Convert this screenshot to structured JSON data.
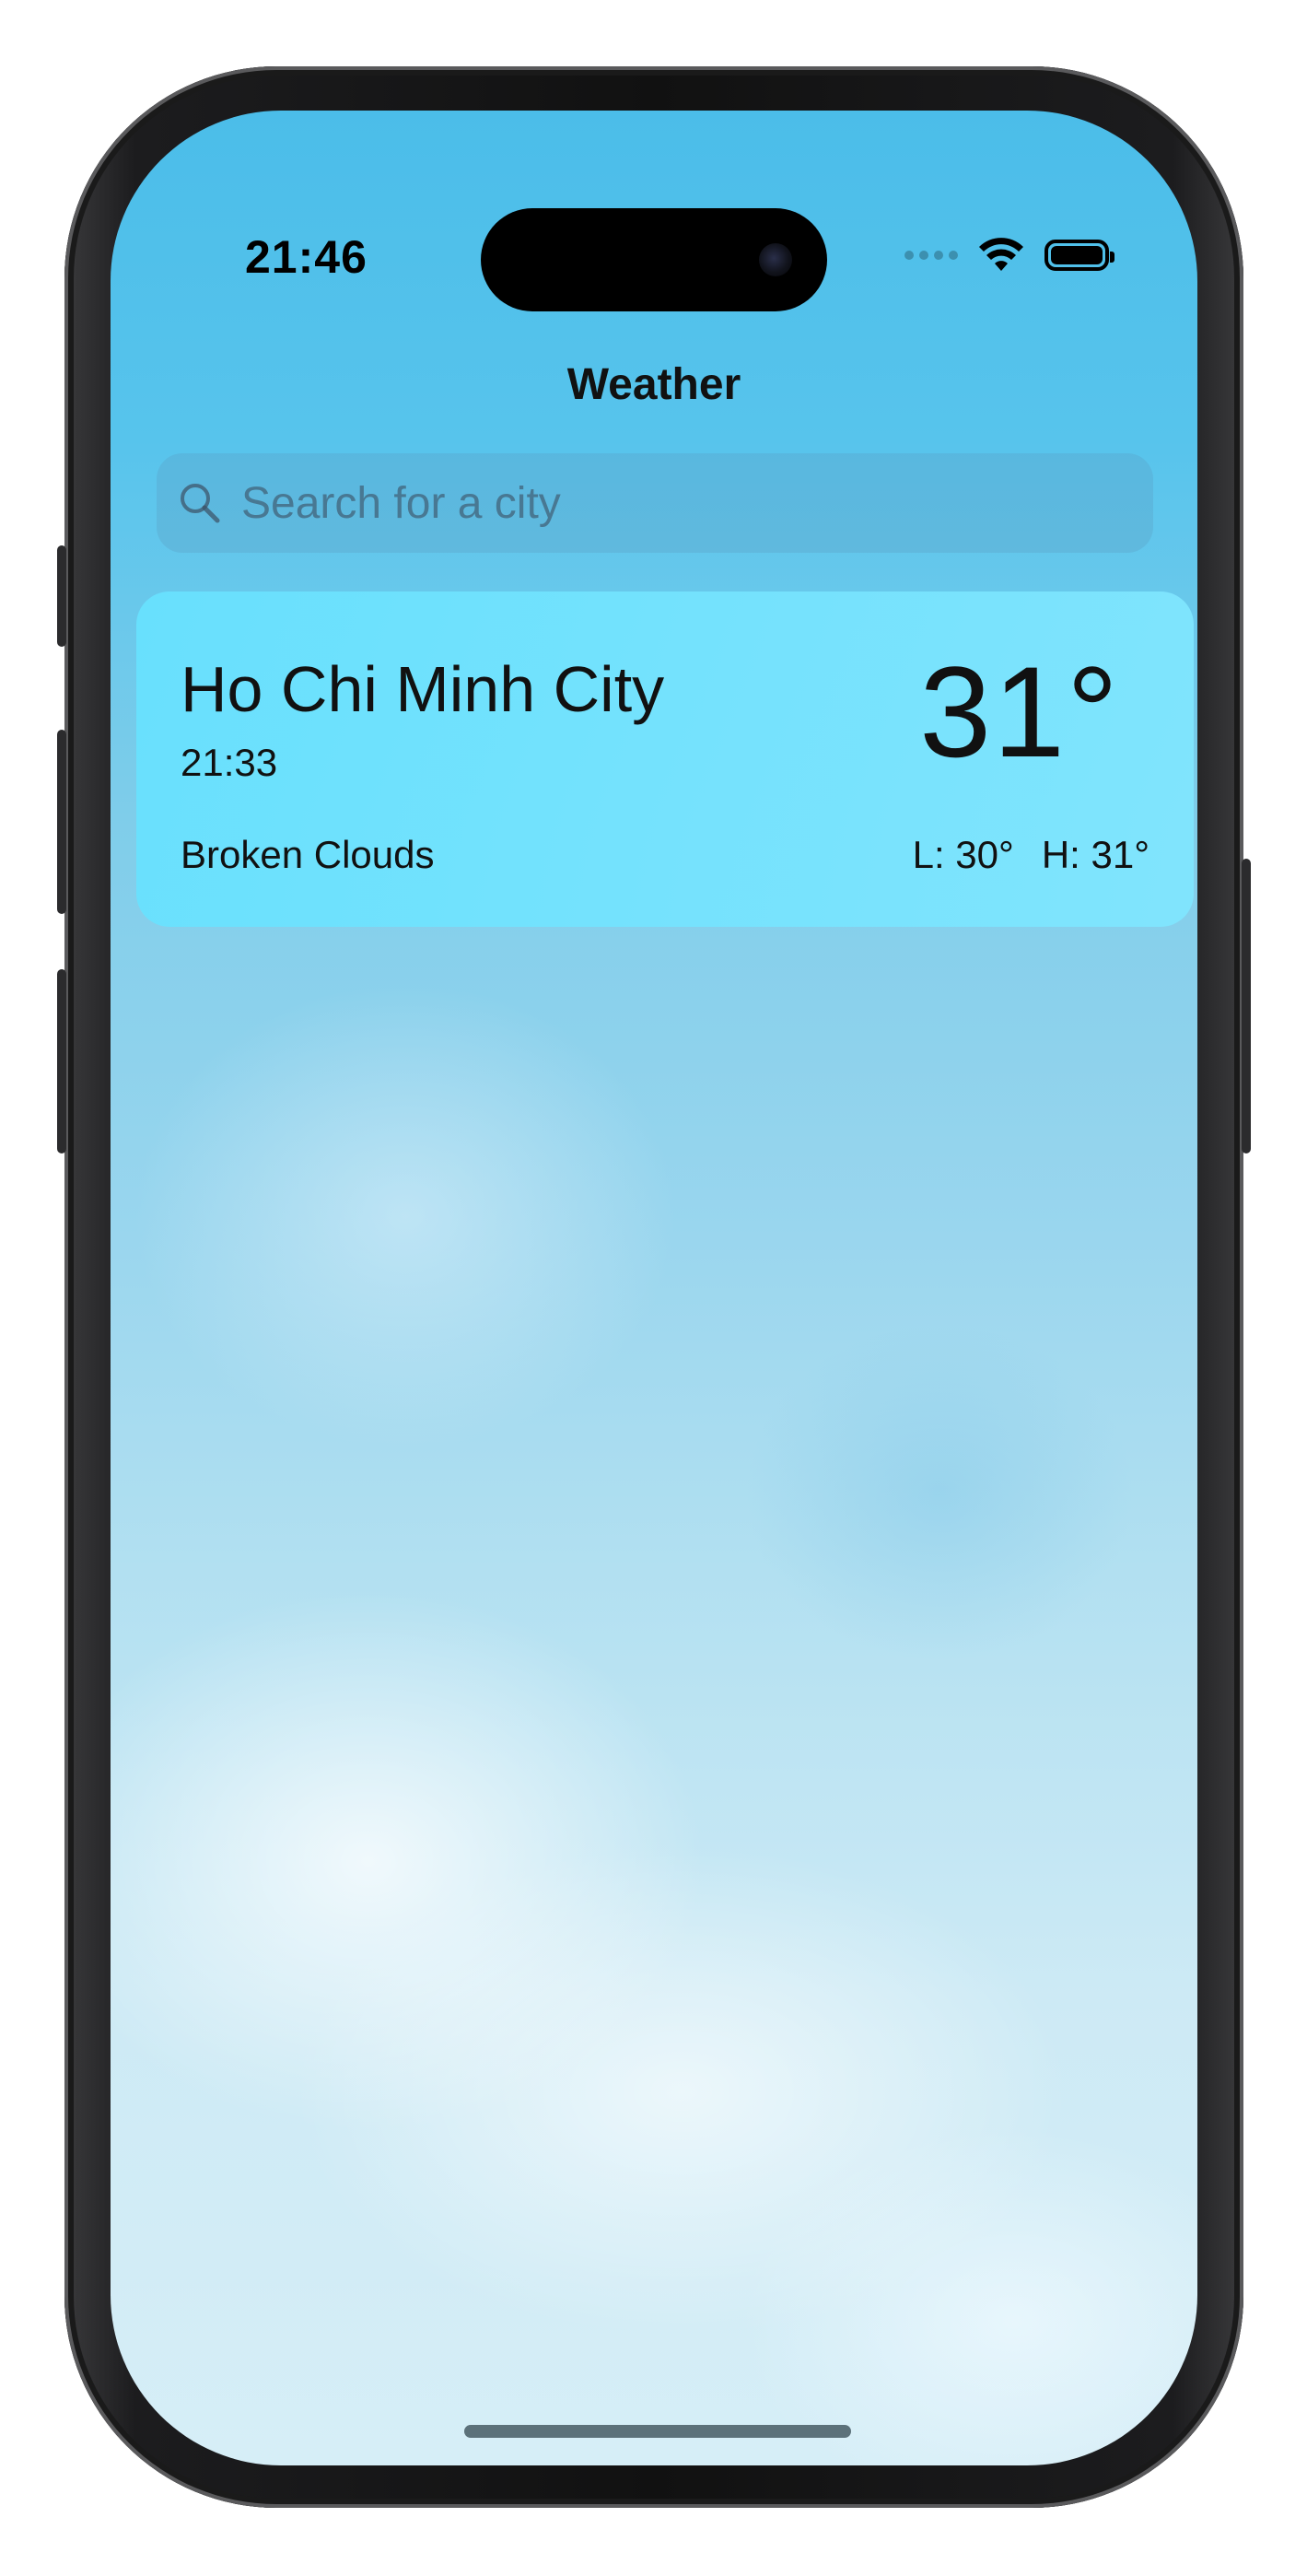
{
  "status_bar": {
    "time": "21:46"
  },
  "nav": {
    "title": "Weather"
  },
  "search": {
    "placeholder": "Search for a city",
    "value": ""
  },
  "locations": [
    {
      "city": "Ho Chi Minh City",
      "local_time": "21:33",
      "temperature": "31°",
      "condition": "Broken Clouds",
      "low": "L: 30°",
      "high": "H: 31°"
    }
  ],
  "colors": {
    "sky_top": "#4bbde9",
    "sky_bottom": "#d6eef7",
    "card_bg": "#68e2ff"
  }
}
